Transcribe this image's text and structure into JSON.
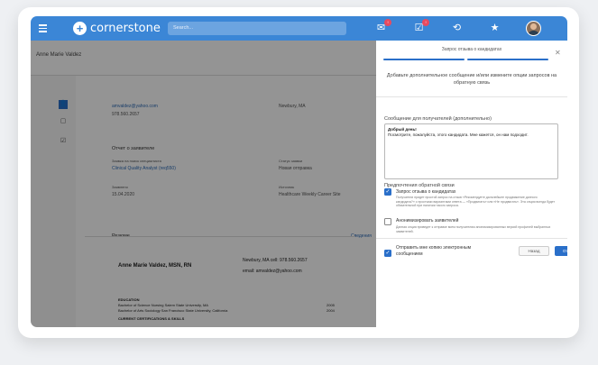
{
  "app": {
    "brand": "cornerstone",
    "search_placeholder": "Search...",
    "notif_badge_1": "!",
    "notif_badge_2": "!"
  },
  "background": {
    "candidate_name": "Anne Marie Valdez",
    "email": "amvaldez@yahoo.com",
    "phone": "978.560.2657",
    "location": "Newbury, MA",
    "report_title": "Отчет о заявителе",
    "req_label": "Заявка на поиск специалиста",
    "req_value": "Clinical Quality Analyst (req550)",
    "status_label": "Статус заявки",
    "status_value": "Новая отправка",
    "applied_label": "Заявлено",
    "applied_value": "15.04.2020",
    "source_label": "Источник",
    "source_value": "Healthcare Weekly Career Site",
    "resume_label": "Резюме",
    "resume_link": "Сведения",
    "resume_name": "Anne Marie Valdez, MSN, RN",
    "resume_contact": "Newbury, MA cell: 978.560.2657",
    "resume_email": "email: amvaldez@yahoo.com",
    "education": "EDUCATION",
    "edu1": "Bachelor of Science Nursing Salem State University, MA",
    "edu1_year": "2005",
    "edu2": "Bachelor of Arts Sociology San Francisco State University, California",
    "edu2_year": "2004",
    "certs": "CURRENT CERTIFICATIONS & SKILLS"
  },
  "modal": {
    "title": "Запрос отзыва о кандидатах",
    "heading": "Добавьте дополнительное сообщение и/или измените опции запросов на обратную связь",
    "message_label": "Сообщение для получателей (дополнительно)",
    "message_line1": "Добрый день!",
    "message_line2": "Посмотрите, пожалуйста, этого кандидата. Мне кажется, он нам подходит.",
    "prefs_label": "Предпочтения обратной связи",
    "opt1_title": "Запрос отзыва о кандидатах",
    "opt1_desc": "Получатели придет простой запрос на отзыв «Рекомендуете дальнейшее продвижение данного кандидата?» с простыми вариантами ответа — «Продвигать» или «Не продвигать». Эта опция всегда будет обязательной при наличии такого запроса.",
    "opt2_title": "Анонимизировать заявителей",
    "opt2_desc": "Данная опция приведет к отправке всем получателям анонимизированных версий профилей выбранных заявителей.",
    "send_copy": "Отправить мне копию электронным сообщением",
    "back": "Назад",
    "send": "Отправить"
  },
  "colors": {
    "accent": "#3b86d6",
    "primary_button": "#2a6fc9"
  }
}
